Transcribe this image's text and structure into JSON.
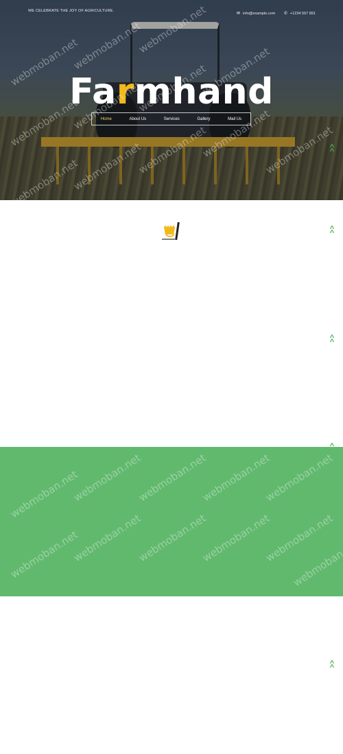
{
  "header": {
    "tagline": "WE CELEBRATE THE JOY OF AGRICULTURE.",
    "email": "info@example.com",
    "phone": "+1234 567 891",
    "email_icon": "envelope-icon",
    "phone_icon": "phone-icon"
  },
  "hero": {
    "logo_prefix": "Fa",
    "logo_accent": "r",
    "logo_suffix": "mhand"
  },
  "nav": {
    "items": [
      {
        "label": "Home"
      },
      {
        "label": "About Us"
      },
      {
        "label": "Services"
      },
      {
        "label": "Gallery"
      },
      {
        "label": "Mail Us"
      }
    ]
  },
  "watermark": "webmoban.net",
  "colors": {
    "accent": "#f2b81c",
    "green": "#61b96e",
    "arrow": "#4caf50"
  },
  "icons": {
    "scroll_top": "double-chevron-up-icon",
    "wheat_logo": "wheat-logo-icon"
  }
}
